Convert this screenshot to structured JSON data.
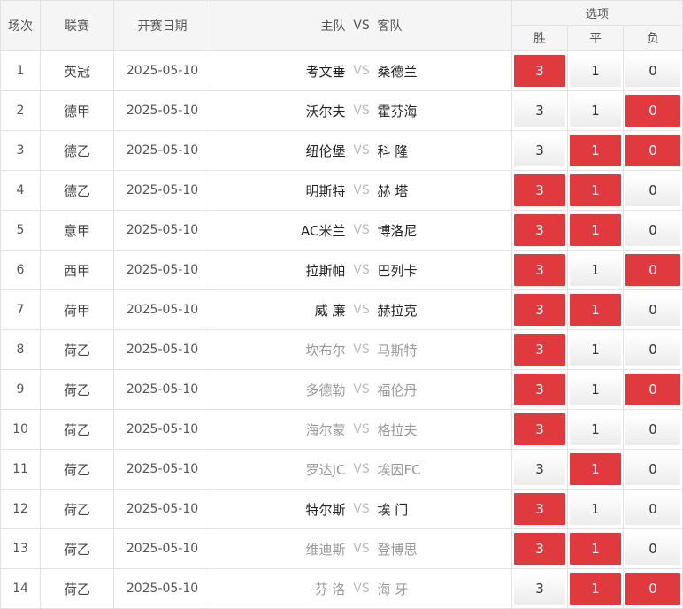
{
  "header": {
    "col_index": "场次",
    "col_league": "联赛",
    "col_date": "开赛日期",
    "col_home": "主队",
    "col_vs": "VS",
    "col_away": "客队",
    "col_options": "选项",
    "opt_win": "胜",
    "opt_draw": "平",
    "opt_lose": "负"
  },
  "colors": {
    "selected": "#e0393e",
    "header_bg": "#f5f5f5"
  },
  "rows": [
    {
      "index": "1",
      "league": "英冠",
      "date": "2025-05-10",
      "home": "考文垂",
      "vs": "VS",
      "away": "桑德兰",
      "muted": false,
      "win": "3",
      "draw": "1",
      "lose": "0",
      "sel": [
        true,
        false,
        false
      ]
    },
    {
      "index": "2",
      "league": "德甲",
      "date": "2025-05-10",
      "home": "沃尔夫",
      "vs": "VS",
      "away": "霍芬海",
      "muted": false,
      "win": "3",
      "draw": "1",
      "lose": "0",
      "sel": [
        false,
        false,
        true
      ]
    },
    {
      "index": "3",
      "league": "德乙",
      "date": "2025-05-10",
      "home": "纽伦堡",
      "vs": "VS",
      "away": "科 隆",
      "muted": false,
      "win": "3",
      "draw": "1",
      "lose": "0",
      "sel": [
        false,
        true,
        true
      ]
    },
    {
      "index": "4",
      "league": "德乙",
      "date": "2025-05-10",
      "home": "明斯特",
      "vs": "VS",
      "away": "赫 塔",
      "muted": false,
      "win": "3",
      "draw": "1",
      "lose": "0",
      "sel": [
        true,
        true,
        false
      ]
    },
    {
      "index": "5",
      "league": "意甲",
      "date": "2025-05-10",
      "home": "AC米兰",
      "vs": "VS",
      "away": "博洛尼",
      "muted": false,
      "win": "3",
      "draw": "1",
      "lose": "0",
      "sel": [
        true,
        true,
        false
      ]
    },
    {
      "index": "6",
      "league": "西甲",
      "date": "2025-05-10",
      "home": "拉斯帕",
      "vs": "VS",
      "away": "巴列卡",
      "muted": false,
      "win": "3",
      "draw": "1",
      "lose": "0",
      "sel": [
        true,
        false,
        true
      ]
    },
    {
      "index": "7",
      "league": "荷甲",
      "date": "2025-05-10",
      "home": "威 廉",
      "vs": "VS",
      "away": "赫拉克",
      "muted": false,
      "win": "3",
      "draw": "1",
      "lose": "0",
      "sel": [
        true,
        true,
        false
      ]
    },
    {
      "index": "8",
      "league": "荷乙",
      "date": "2025-05-10",
      "home": "坎布尔",
      "vs": "VS",
      "away": "马斯特",
      "muted": true,
      "win": "3",
      "draw": "1",
      "lose": "0",
      "sel": [
        true,
        false,
        false
      ]
    },
    {
      "index": "9",
      "league": "荷乙",
      "date": "2025-05-10",
      "home": "多德勒",
      "vs": "VS",
      "away": "福伦丹",
      "muted": true,
      "win": "3",
      "draw": "1",
      "lose": "0",
      "sel": [
        true,
        false,
        true
      ]
    },
    {
      "index": "10",
      "league": "荷乙",
      "date": "2025-05-10",
      "home": "海尔蒙",
      "vs": "VS",
      "away": "格拉夫",
      "muted": true,
      "win": "3",
      "draw": "1",
      "lose": "0",
      "sel": [
        true,
        false,
        false
      ]
    },
    {
      "index": "11",
      "league": "荷乙",
      "date": "2025-05-10",
      "home": "罗达JC",
      "vs": "VS",
      "away": "埃因FC",
      "muted": true,
      "win": "3",
      "draw": "1",
      "lose": "0",
      "sel": [
        false,
        true,
        false
      ]
    },
    {
      "index": "12",
      "league": "荷乙",
      "date": "2025-05-10",
      "home": "特尔斯",
      "vs": "VS",
      "away": "埃 门",
      "muted": false,
      "win": "3",
      "draw": "1",
      "lose": "0",
      "sel": [
        true,
        false,
        false
      ]
    },
    {
      "index": "13",
      "league": "荷乙",
      "date": "2025-05-10",
      "home": "维迪斯",
      "vs": "VS",
      "away": "登博思",
      "muted": true,
      "win": "3",
      "draw": "1",
      "lose": "0",
      "sel": [
        true,
        true,
        false
      ]
    },
    {
      "index": "14",
      "league": "荷乙",
      "date": "2025-05-10",
      "home": "芬 洛",
      "vs": "VS",
      "away": "海 牙",
      "muted": true,
      "win": "3",
      "draw": "1",
      "lose": "0",
      "sel": [
        false,
        true,
        true
      ]
    }
  ]
}
